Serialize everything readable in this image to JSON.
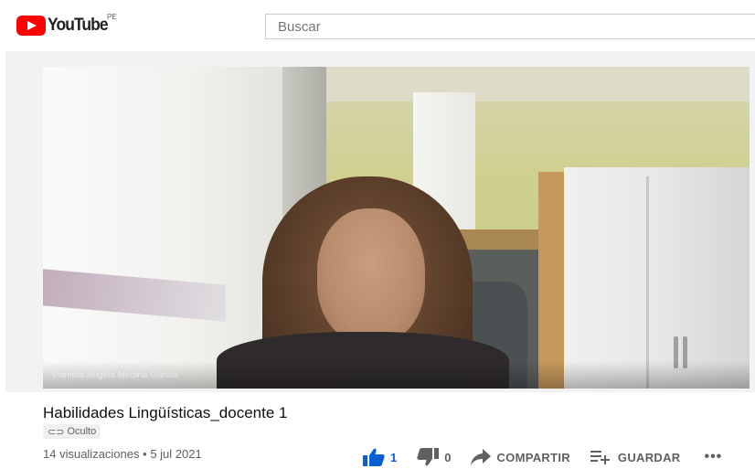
{
  "masthead": {
    "logo_text": "YouTube",
    "region": "PE",
    "search_placeholder": "Buscar"
  },
  "video": {
    "name_overlay": "Pamela Ángela Medina García"
  },
  "info": {
    "title": "Habilidades Lingüísticas_docente 1",
    "visibility_badge": "Oculto",
    "views": "14 visualizaciones",
    "separator": "•",
    "date": "5 jul 2021"
  },
  "actions": {
    "like_count": "1",
    "dislike_count": "0",
    "share_label": "COMPARTIR",
    "save_label": "GUARDAR",
    "more_label": "•••"
  },
  "colors": {
    "brand_red": "#ff0000",
    "like_blue": "#065fd4",
    "secondary_text": "#606060"
  },
  "icons": {
    "logo": "youtube-play-icon",
    "badge": "link-icon",
    "like": "thumbs-up-icon",
    "dislike": "thumbs-down-icon",
    "share": "share-arrow-icon",
    "save": "playlist-add-icon",
    "more": "more-horizontal-icon"
  }
}
